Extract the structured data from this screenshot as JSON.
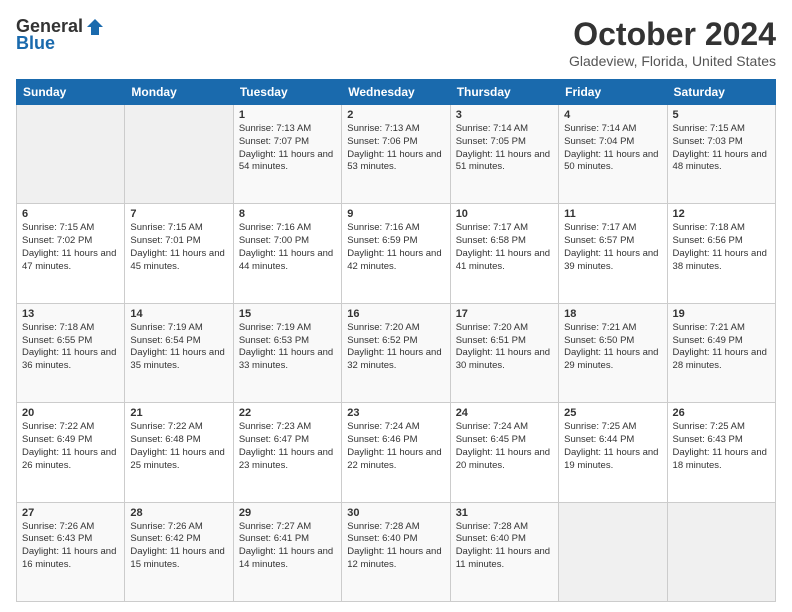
{
  "header": {
    "logo_general": "General",
    "logo_blue": "Blue",
    "month_title": "October 2024",
    "location": "Gladeview, Florida, United States"
  },
  "weekdays": [
    "Sunday",
    "Monday",
    "Tuesday",
    "Wednesday",
    "Thursday",
    "Friday",
    "Saturday"
  ],
  "weeks": [
    [
      {
        "day": "",
        "info": ""
      },
      {
        "day": "",
        "info": ""
      },
      {
        "day": "1",
        "info": "Sunrise: 7:13 AM\nSunset: 7:07 PM\nDaylight: 11 hours and 54 minutes."
      },
      {
        "day": "2",
        "info": "Sunrise: 7:13 AM\nSunset: 7:06 PM\nDaylight: 11 hours and 53 minutes."
      },
      {
        "day": "3",
        "info": "Sunrise: 7:14 AM\nSunset: 7:05 PM\nDaylight: 11 hours and 51 minutes."
      },
      {
        "day": "4",
        "info": "Sunrise: 7:14 AM\nSunset: 7:04 PM\nDaylight: 11 hours and 50 minutes."
      },
      {
        "day": "5",
        "info": "Sunrise: 7:15 AM\nSunset: 7:03 PM\nDaylight: 11 hours and 48 minutes."
      }
    ],
    [
      {
        "day": "6",
        "info": "Sunrise: 7:15 AM\nSunset: 7:02 PM\nDaylight: 11 hours and 47 minutes."
      },
      {
        "day": "7",
        "info": "Sunrise: 7:15 AM\nSunset: 7:01 PM\nDaylight: 11 hours and 45 minutes."
      },
      {
        "day": "8",
        "info": "Sunrise: 7:16 AM\nSunset: 7:00 PM\nDaylight: 11 hours and 44 minutes."
      },
      {
        "day": "9",
        "info": "Sunrise: 7:16 AM\nSunset: 6:59 PM\nDaylight: 11 hours and 42 minutes."
      },
      {
        "day": "10",
        "info": "Sunrise: 7:17 AM\nSunset: 6:58 PM\nDaylight: 11 hours and 41 minutes."
      },
      {
        "day": "11",
        "info": "Sunrise: 7:17 AM\nSunset: 6:57 PM\nDaylight: 11 hours and 39 minutes."
      },
      {
        "day": "12",
        "info": "Sunrise: 7:18 AM\nSunset: 6:56 PM\nDaylight: 11 hours and 38 minutes."
      }
    ],
    [
      {
        "day": "13",
        "info": "Sunrise: 7:18 AM\nSunset: 6:55 PM\nDaylight: 11 hours and 36 minutes."
      },
      {
        "day": "14",
        "info": "Sunrise: 7:19 AM\nSunset: 6:54 PM\nDaylight: 11 hours and 35 minutes."
      },
      {
        "day": "15",
        "info": "Sunrise: 7:19 AM\nSunset: 6:53 PM\nDaylight: 11 hours and 33 minutes."
      },
      {
        "day": "16",
        "info": "Sunrise: 7:20 AM\nSunset: 6:52 PM\nDaylight: 11 hours and 32 minutes."
      },
      {
        "day": "17",
        "info": "Sunrise: 7:20 AM\nSunset: 6:51 PM\nDaylight: 11 hours and 30 minutes."
      },
      {
        "day": "18",
        "info": "Sunrise: 7:21 AM\nSunset: 6:50 PM\nDaylight: 11 hours and 29 minutes."
      },
      {
        "day": "19",
        "info": "Sunrise: 7:21 AM\nSunset: 6:49 PM\nDaylight: 11 hours and 28 minutes."
      }
    ],
    [
      {
        "day": "20",
        "info": "Sunrise: 7:22 AM\nSunset: 6:49 PM\nDaylight: 11 hours and 26 minutes."
      },
      {
        "day": "21",
        "info": "Sunrise: 7:22 AM\nSunset: 6:48 PM\nDaylight: 11 hours and 25 minutes."
      },
      {
        "day": "22",
        "info": "Sunrise: 7:23 AM\nSunset: 6:47 PM\nDaylight: 11 hours and 23 minutes."
      },
      {
        "day": "23",
        "info": "Sunrise: 7:24 AM\nSunset: 6:46 PM\nDaylight: 11 hours and 22 minutes."
      },
      {
        "day": "24",
        "info": "Sunrise: 7:24 AM\nSunset: 6:45 PM\nDaylight: 11 hours and 20 minutes."
      },
      {
        "day": "25",
        "info": "Sunrise: 7:25 AM\nSunset: 6:44 PM\nDaylight: 11 hours and 19 minutes."
      },
      {
        "day": "26",
        "info": "Sunrise: 7:25 AM\nSunset: 6:43 PM\nDaylight: 11 hours and 18 minutes."
      }
    ],
    [
      {
        "day": "27",
        "info": "Sunrise: 7:26 AM\nSunset: 6:43 PM\nDaylight: 11 hours and 16 minutes."
      },
      {
        "day": "28",
        "info": "Sunrise: 7:26 AM\nSunset: 6:42 PM\nDaylight: 11 hours and 15 minutes."
      },
      {
        "day": "29",
        "info": "Sunrise: 7:27 AM\nSunset: 6:41 PM\nDaylight: 11 hours and 14 minutes."
      },
      {
        "day": "30",
        "info": "Sunrise: 7:28 AM\nSunset: 6:40 PM\nDaylight: 11 hours and 12 minutes."
      },
      {
        "day": "31",
        "info": "Sunrise: 7:28 AM\nSunset: 6:40 PM\nDaylight: 11 hours and 11 minutes."
      },
      {
        "day": "",
        "info": ""
      },
      {
        "day": "",
        "info": ""
      }
    ]
  ]
}
